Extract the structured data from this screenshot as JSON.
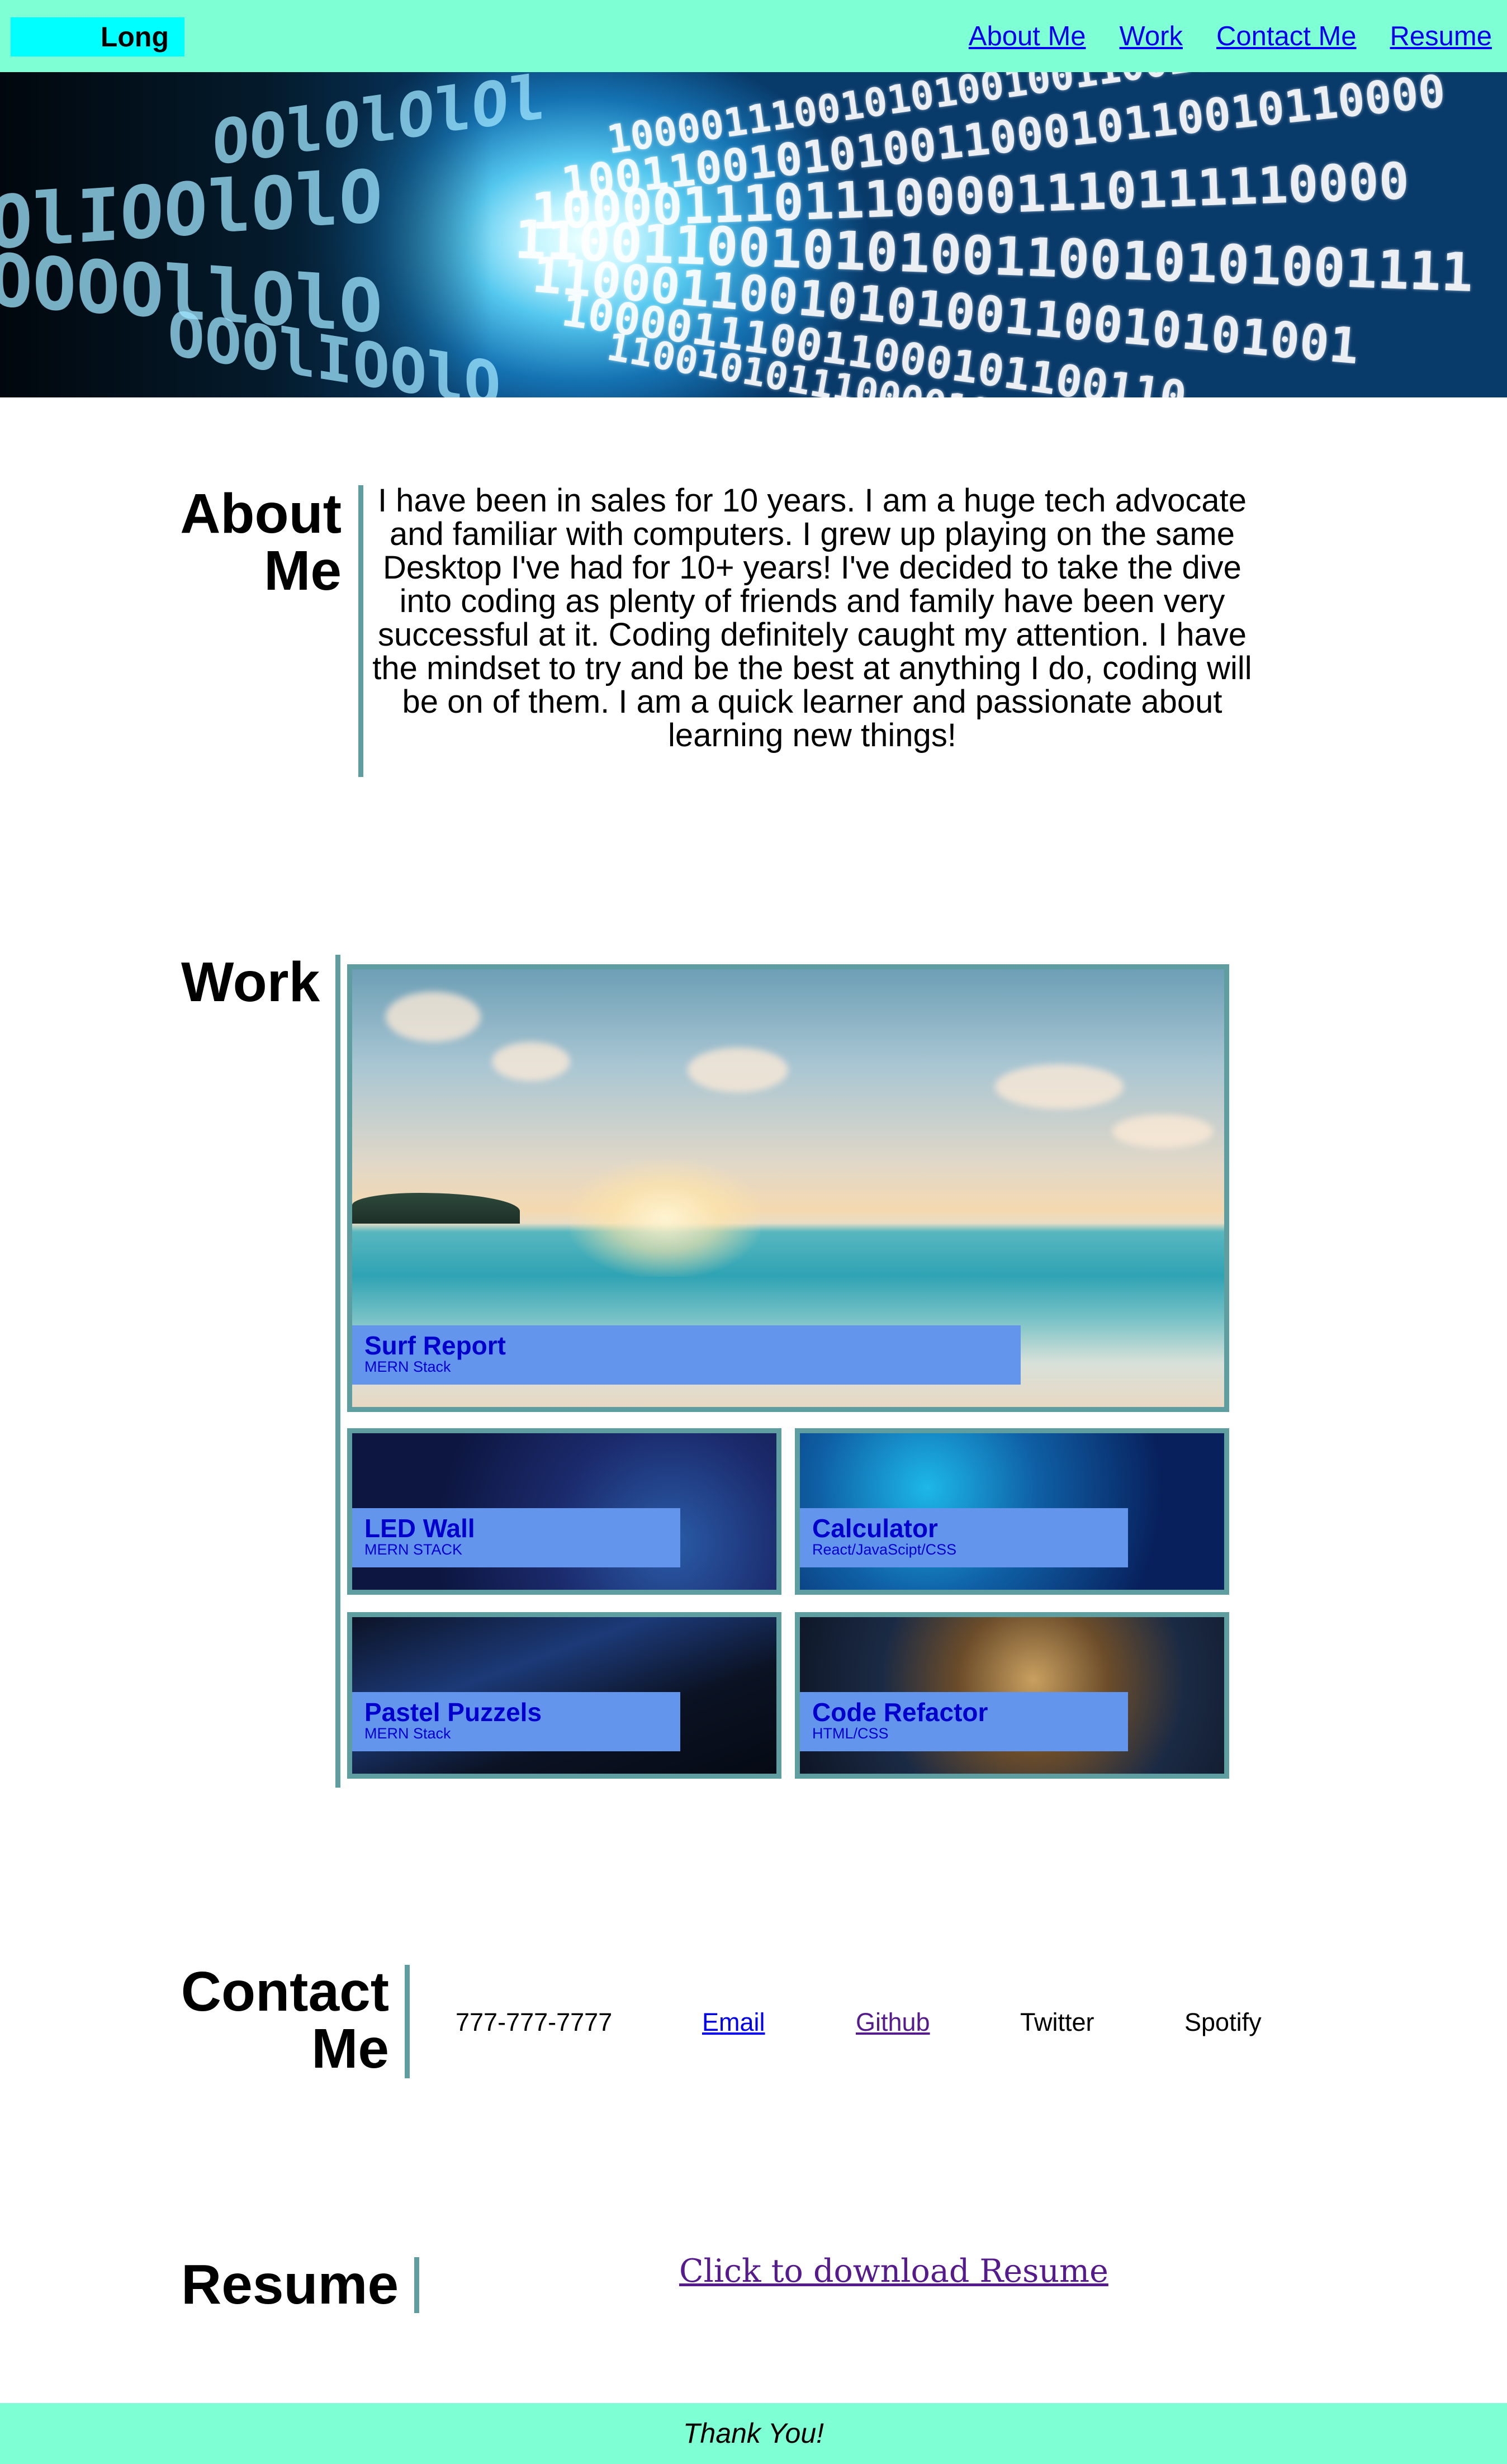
{
  "header": {
    "logo": "Long",
    "nav": [
      "About Me",
      "Work",
      "Contact Me",
      "Resume"
    ]
  },
  "hero": {
    "image": "binary-code-tunnel",
    "binary_rows_left": [
      "OOlOlOlOl",
      "OlIOOlOlO",
      "OOOOllOlO",
      "OOOlIOOlO"
    ],
    "binary_rows_right": [
      "1000011100101010010011001011000",
      "100110010101001100010110010110000",
      "10000111011100001110111110000",
      "110011001010100110010101001111",
      "1100011001010100110010101001",
      "100001110011000101100110",
      "1100101011100001011000"
    ]
  },
  "about": {
    "title_line1": "About",
    "title_line2": "Me",
    "text": "I have been in sales for 10 years. I am a huge tech advocate and familiar with computers. I grew up playing on the same Desktop I've had for 10+ years! I've decided to take the dive into coding as plenty of friends and family have been very successful at it. Coding definitely caught my attention. I have the mindset to try and be the best at anything I do, coding will be on of them. I am a quick learner and passionate about learning new things!"
  },
  "work": {
    "title": "Work",
    "projects": [
      {
        "title": "Surf Report",
        "stack": "MERN Stack",
        "image": "beach-sunset"
      },
      {
        "title": "LED Wall",
        "stack": "MERN STACK",
        "image": "tech-network"
      },
      {
        "title": "Calculator",
        "stack": "React/JavaScipt/CSS",
        "image": "circuit-board"
      },
      {
        "title": "Pastel Puzzels",
        "stack": "MERN Stack",
        "image": "digital-corridor"
      },
      {
        "title": "Code Refactor",
        "stack": "HTML/CSS",
        "image": "clock-gears"
      }
    ]
  },
  "contact": {
    "title_line1": "Contact",
    "title_line2": "Me",
    "phone": "777-777-7777",
    "email": "Email",
    "github": "Github",
    "twitter": "Twitter",
    "spotify": "Spotify"
  },
  "resume": {
    "title": "Resume",
    "link": "Click to download Resume"
  },
  "footer": {
    "text": "Thank You!"
  }
}
